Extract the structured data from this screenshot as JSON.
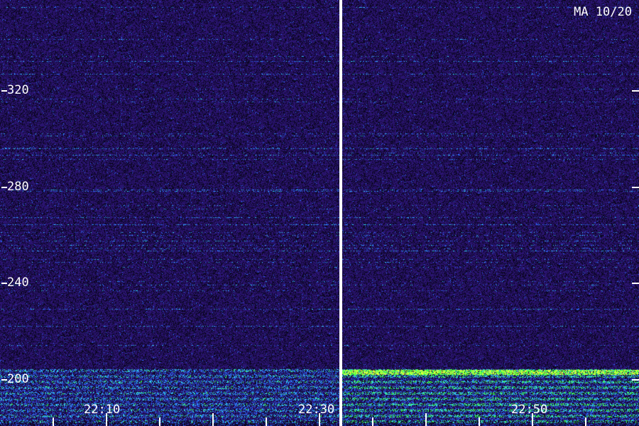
{
  "station_label": "MA 10/20",
  "y_axis": {
    "ticks": [
      "320",
      "280",
      "240",
      "200"
    ]
  },
  "x_axis": {
    "ticks": [
      "22:10",
      "22:30",
      "22:50"
    ]
  },
  "colors": {
    "background_noise": "#2a1470",
    "dark_noise": "#0b0620",
    "band_blue": "#2a6cff",
    "band_cyan": "#36d4ff",
    "band_green": "#3dff4a",
    "band_yellow": "#e8ff3a",
    "divider": "#ffffff",
    "text": "#ffffff"
  }
}
